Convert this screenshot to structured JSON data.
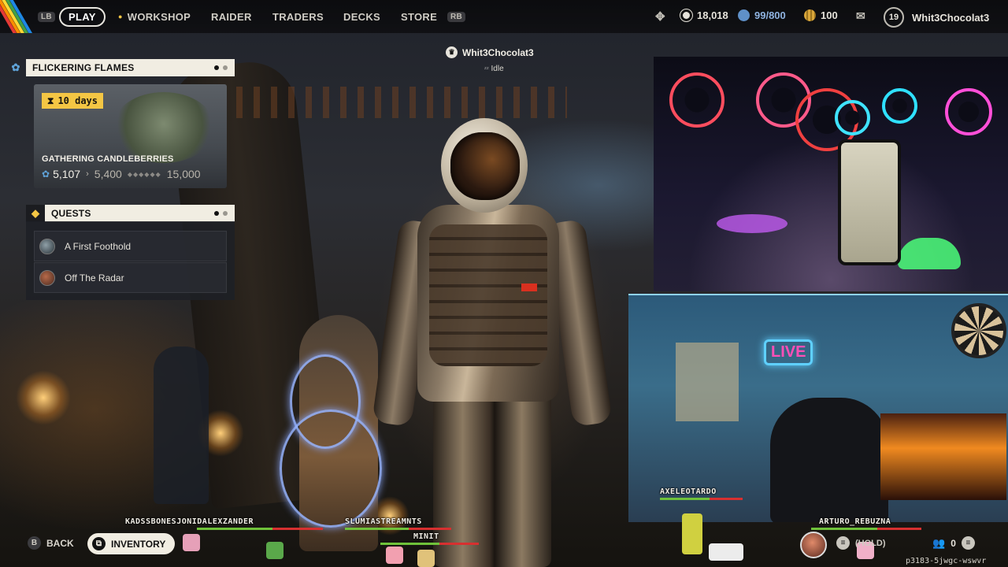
{
  "nav": {
    "lb": "LB",
    "rb": "RB",
    "items": [
      "PLAY",
      "WORKSHOP",
      "RAIDER",
      "TRADERS",
      "DECKS",
      "STORE"
    ],
    "active": "PLAY"
  },
  "resources": {
    "raider_tokens": "18,018",
    "cred": "99/800",
    "coins": "100",
    "level": "19",
    "username": "Whit3Chocolat3"
  },
  "event": {
    "title": "FLICKERING FLAMES",
    "timer": "10 days",
    "name": "GATHERING CANDLEBERRIES",
    "current": "5,107",
    "next": "5,400",
    "max": "15,000"
  },
  "quests": {
    "title": "QUESTS",
    "items": [
      "A First Foothold",
      "Off The Radar"
    ]
  },
  "player": {
    "name": "Whit3Chocolat3",
    "status": "Idle"
  },
  "overlay": {
    "live_sign": "LIVE",
    "chat_names": [
      "KADSSBONESJONIDALEXZANDER",
      "SLUMIASTREAMNTS",
      "MINIT",
      "AXELEOTARDO",
      "ARTURO_REBUZNA"
    ]
  },
  "footer": {
    "back_key": "B",
    "back": "BACK",
    "inventory": "INVENTORY",
    "chat_hold": "(HOLD)",
    "party_count": "0",
    "session_id": "p3183-5jwgc-wswvr"
  },
  "colors": {
    "accent": "#f4c644",
    "panel_header": "#f1ede2",
    "stripe_colors": [
      "#e53935",
      "#fb8c00",
      "#fdd835",
      "#43a047",
      "#1e88e5"
    ]
  }
}
